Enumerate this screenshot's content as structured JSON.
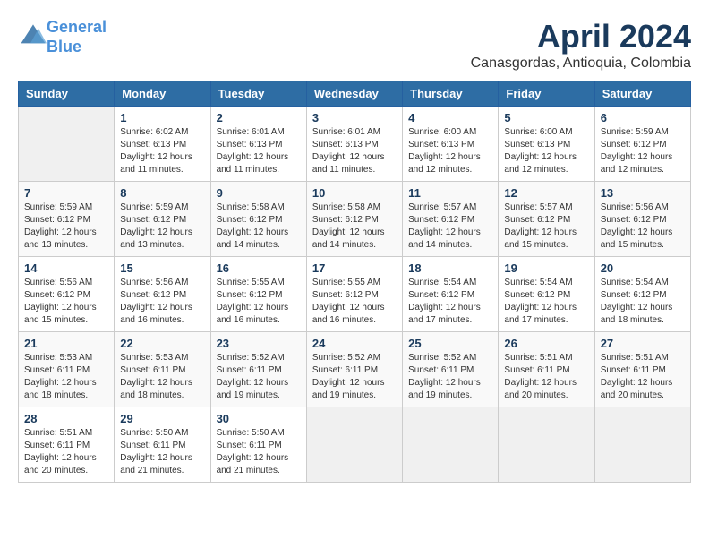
{
  "header": {
    "logo_line1": "General",
    "logo_line2": "Blue",
    "month": "April 2024",
    "location": "Canasgordas, Antioquia, Colombia"
  },
  "weekdays": [
    "Sunday",
    "Monday",
    "Tuesday",
    "Wednesday",
    "Thursday",
    "Friday",
    "Saturday"
  ],
  "weeks": [
    [
      {
        "day": "",
        "sunrise": "",
        "sunset": "",
        "daylight": ""
      },
      {
        "day": "1",
        "sunrise": "Sunrise: 6:02 AM",
        "sunset": "Sunset: 6:13 PM",
        "daylight": "Daylight: 12 hours and 11 minutes."
      },
      {
        "day": "2",
        "sunrise": "Sunrise: 6:01 AM",
        "sunset": "Sunset: 6:13 PM",
        "daylight": "Daylight: 12 hours and 11 minutes."
      },
      {
        "day": "3",
        "sunrise": "Sunrise: 6:01 AM",
        "sunset": "Sunset: 6:13 PM",
        "daylight": "Daylight: 12 hours and 11 minutes."
      },
      {
        "day": "4",
        "sunrise": "Sunrise: 6:00 AM",
        "sunset": "Sunset: 6:13 PM",
        "daylight": "Daylight: 12 hours and 12 minutes."
      },
      {
        "day": "5",
        "sunrise": "Sunrise: 6:00 AM",
        "sunset": "Sunset: 6:13 PM",
        "daylight": "Daylight: 12 hours and 12 minutes."
      },
      {
        "day": "6",
        "sunrise": "Sunrise: 5:59 AM",
        "sunset": "Sunset: 6:12 PM",
        "daylight": "Daylight: 12 hours and 12 minutes."
      }
    ],
    [
      {
        "day": "7",
        "sunrise": "Sunrise: 5:59 AM",
        "sunset": "Sunset: 6:12 PM",
        "daylight": "Daylight: 12 hours and 13 minutes."
      },
      {
        "day": "8",
        "sunrise": "Sunrise: 5:59 AM",
        "sunset": "Sunset: 6:12 PM",
        "daylight": "Daylight: 12 hours and 13 minutes."
      },
      {
        "day": "9",
        "sunrise": "Sunrise: 5:58 AM",
        "sunset": "Sunset: 6:12 PM",
        "daylight": "Daylight: 12 hours and 14 minutes."
      },
      {
        "day": "10",
        "sunrise": "Sunrise: 5:58 AM",
        "sunset": "Sunset: 6:12 PM",
        "daylight": "Daylight: 12 hours and 14 minutes."
      },
      {
        "day": "11",
        "sunrise": "Sunrise: 5:57 AM",
        "sunset": "Sunset: 6:12 PM",
        "daylight": "Daylight: 12 hours and 14 minutes."
      },
      {
        "day": "12",
        "sunrise": "Sunrise: 5:57 AM",
        "sunset": "Sunset: 6:12 PM",
        "daylight": "Daylight: 12 hours and 15 minutes."
      },
      {
        "day": "13",
        "sunrise": "Sunrise: 5:56 AM",
        "sunset": "Sunset: 6:12 PM",
        "daylight": "Daylight: 12 hours and 15 minutes."
      }
    ],
    [
      {
        "day": "14",
        "sunrise": "Sunrise: 5:56 AM",
        "sunset": "Sunset: 6:12 PM",
        "daylight": "Daylight: 12 hours and 15 minutes."
      },
      {
        "day": "15",
        "sunrise": "Sunrise: 5:56 AM",
        "sunset": "Sunset: 6:12 PM",
        "daylight": "Daylight: 12 hours and 16 minutes."
      },
      {
        "day": "16",
        "sunrise": "Sunrise: 5:55 AM",
        "sunset": "Sunset: 6:12 PM",
        "daylight": "Daylight: 12 hours and 16 minutes."
      },
      {
        "day": "17",
        "sunrise": "Sunrise: 5:55 AM",
        "sunset": "Sunset: 6:12 PM",
        "daylight": "Daylight: 12 hours and 16 minutes."
      },
      {
        "day": "18",
        "sunrise": "Sunrise: 5:54 AM",
        "sunset": "Sunset: 6:12 PM",
        "daylight": "Daylight: 12 hours and 17 minutes."
      },
      {
        "day": "19",
        "sunrise": "Sunrise: 5:54 AM",
        "sunset": "Sunset: 6:12 PM",
        "daylight": "Daylight: 12 hours and 17 minutes."
      },
      {
        "day": "20",
        "sunrise": "Sunrise: 5:54 AM",
        "sunset": "Sunset: 6:12 PM",
        "daylight": "Daylight: 12 hours and 18 minutes."
      }
    ],
    [
      {
        "day": "21",
        "sunrise": "Sunrise: 5:53 AM",
        "sunset": "Sunset: 6:11 PM",
        "daylight": "Daylight: 12 hours and 18 minutes."
      },
      {
        "day": "22",
        "sunrise": "Sunrise: 5:53 AM",
        "sunset": "Sunset: 6:11 PM",
        "daylight": "Daylight: 12 hours and 18 minutes."
      },
      {
        "day": "23",
        "sunrise": "Sunrise: 5:52 AM",
        "sunset": "Sunset: 6:11 PM",
        "daylight": "Daylight: 12 hours and 19 minutes."
      },
      {
        "day": "24",
        "sunrise": "Sunrise: 5:52 AM",
        "sunset": "Sunset: 6:11 PM",
        "daylight": "Daylight: 12 hours and 19 minutes."
      },
      {
        "day": "25",
        "sunrise": "Sunrise: 5:52 AM",
        "sunset": "Sunset: 6:11 PM",
        "daylight": "Daylight: 12 hours and 19 minutes."
      },
      {
        "day": "26",
        "sunrise": "Sunrise: 5:51 AM",
        "sunset": "Sunset: 6:11 PM",
        "daylight": "Daylight: 12 hours and 20 minutes."
      },
      {
        "day": "27",
        "sunrise": "Sunrise: 5:51 AM",
        "sunset": "Sunset: 6:11 PM",
        "daylight": "Daylight: 12 hours and 20 minutes."
      }
    ],
    [
      {
        "day": "28",
        "sunrise": "Sunrise: 5:51 AM",
        "sunset": "Sunset: 6:11 PM",
        "daylight": "Daylight: 12 hours and 20 minutes."
      },
      {
        "day": "29",
        "sunrise": "Sunrise: 5:50 AM",
        "sunset": "Sunset: 6:11 PM",
        "daylight": "Daylight: 12 hours and 21 minutes."
      },
      {
        "day": "30",
        "sunrise": "Sunrise: 5:50 AM",
        "sunset": "Sunset: 6:11 PM",
        "daylight": "Daylight: 12 hours and 21 minutes."
      },
      {
        "day": "",
        "sunrise": "",
        "sunset": "",
        "daylight": ""
      },
      {
        "day": "",
        "sunrise": "",
        "sunset": "",
        "daylight": ""
      },
      {
        "day": "",
        "sunrise": "",
        "sunset": "",
        "daylight": ""
      },
      {
        "day": "",
        "sunrise": "",
        "sunset": "",
        "daylight": ""
      }
    ]
  ]
}
